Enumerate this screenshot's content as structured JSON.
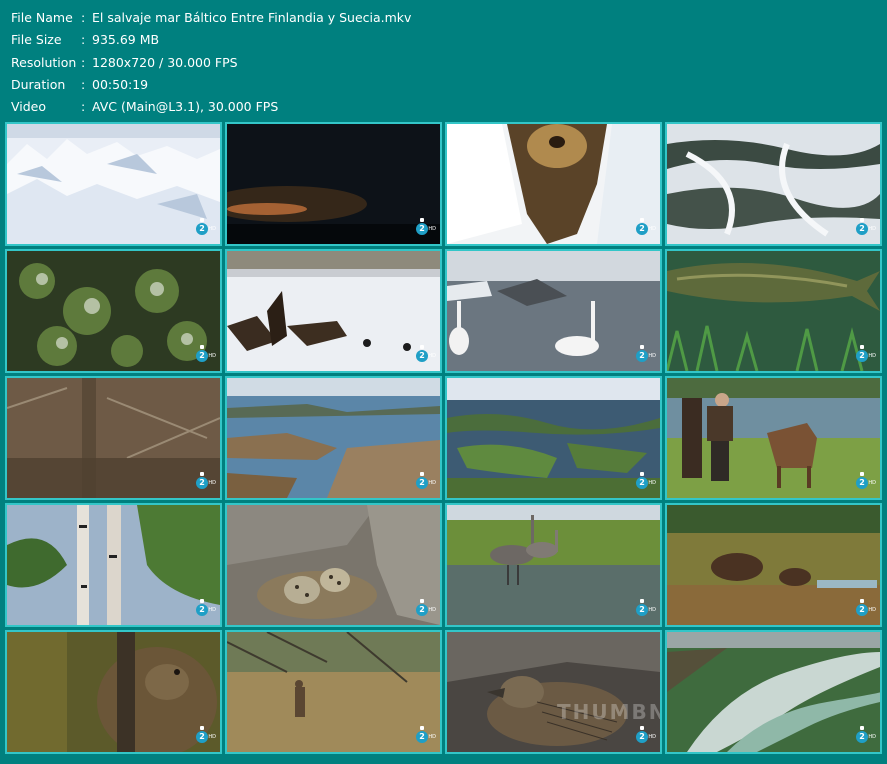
{
  "info": {
    "file_name_label": "File Name",
    "file_name": "El salvaje mar Báltico Entre Finlandia y Suecia.mkv",
    "file_size_label": "File Size",
    "file_size": "935.69 MB",
    "resolution_label": "Resolution",
    "resolution": "1280x720 / 30.000 FPS",
    "duration_label": "Duration",
    "duration": "00:50:19",
    "video_label": "Video",
    "video": "AVC (Main@L3.1), 30.000 FPS",
    "separator": ":"
  },
  "channel_logo": {
    "text": "2",
    "suffix": "HD"
  },
  "watermark": "THUMBNAILS",
  "thumbnails": [
    {
      "name": "snow-ice-ridges",
      "kind": "snow"
    },
    {
      "name": "night-sky-sunset",
      "kind": "night"
    },
    {
      "name": "seal-in-ice-hole",
      "kind": "seal"
    },
    {
      "name": "aerial-frozen-river",
      "kind": "riverice"
    },
    {
      "name": "aerial-snowy-forest",
      "kind": "forest"
    },
    {
      "name": "eagles-on-snow",
      "kind": "eagles"
    },
    {
      "name": "swans-on-water",
      "kind": "swans"
    },
    {
      "name": "pike-underwater",
      "kind": "pike"
    },
    {
      "name": "tree-trunk-woods",
      "kind": "woods"
    },
    {
      "name": "rocky-archipelago",
      "kind": "archipelago"
    },
    {
      "name": "aerial-lake-islands",
      "kind": "lakeaerial"
    },
    {
      "name": "man-with-moose-calf",
      "kind": "moose"
    },
    {
      "name": "birch-trees",
      "kind": "birch"
    },
    {
      "name": "bird-nest-eggs",
      "kind": "nest"
    },
    {
      "name": "cranes-in-reeds",
      "kind": "cranes"
    },
    {
      "name": "bears-in-meadow",
      "kind": "bears"
    },
    {
      "name": "bear-behind-tree",
      "kind": "bearclose"
    },
    {
      "name": "deer-in-grass",
      "kind": "deer"
    },
    {
      "name": "eider-duck-nest",
      "kind": "duck"
    },
    {
      "name": "aerial-river-delta",
      "kind": "delta"
    }
  ]
}
